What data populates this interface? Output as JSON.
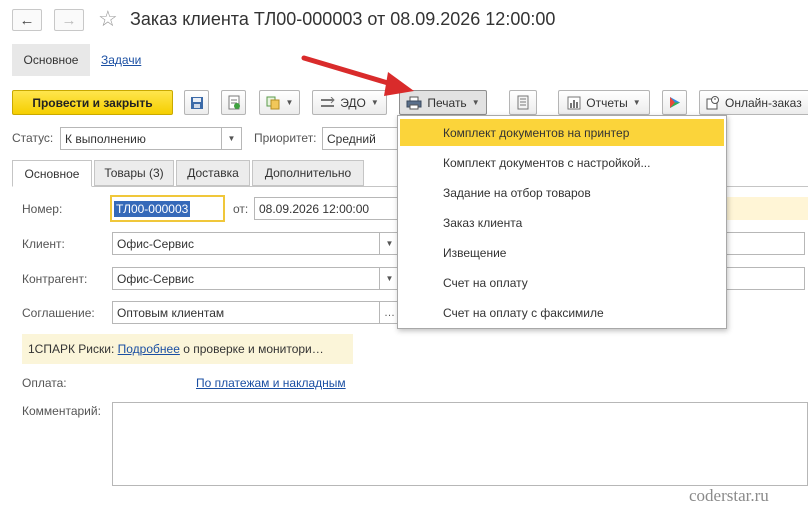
{
  "window": {
    "title": "Заказ клиента ТЛ00-000003 от 08.09.2026 12:00:00",
    "back_icon": "arrow-left-icon",
    "forward_icon": "arrow-right-icon"
  },
  "sections": {
    "main": "Основное",
    "tasks": "Задачи"
  },
  "toolbar": {
    "post_close": "Провести и закрыть",
    "edo": "ЭДО",
    "print": "Печать",
    "reports": "Отчеты",
    "online": "Онлайн-заказ"
  },
  "status": {
    "label": "Статус:",
    "value": "К выполнению",
    "priority_label": "Приоритет:",
    "priority_value": "Средний"
  },
  "tabs": [
    {
      "label": "Основное"
    },
    {
      "label": "Товары (3)"
    },
    {
      "label": "Доставка"
    },
    {
      "label": "Дополнительно"
    }
  ],
  "form": {
    "number_label": "Номер:",
    "number_value": "ТЛ00-000003",
    "date_label": "от:",
    "date_value": "08.09.2026 12:00:00",
    "client_label": "Клиент:",
    "client_value": "Офис-Сервис",
    "contractor_label": "Контрагент:",
    "contractor_value": "Офис-Сервис",
    "agreement_label": "Соглашение:",
    "agreement_value": "Оптовым клиентам",
    "spark_prefix": "1СПАРК Риски:",
    "spark_link": "Подробнее",
    "spark_suffix": "о проверке и монитори…",
    "payment_label": "Оплата:",
    "payment_link": "По платежам и накладным",
    "comment_label": "Комментарий:"
  },
  "print_menu": [
    {
      "label": "Комплект документов на принтер"
    },
    {
      "label": "Комплект документов с настройкой..."
    },
    {
      "label": "Задание на отбор товаров"
    },
    {
      "label": "Заказ клиента"
    },
    {
      "label": "Извещение"
    },
    {
      "label": "Счет на оплату"
    },
    {
      "label": "Счет на оплату с факсимиле"
    }
  ],
  "watermark": "coderstar.ru",
  "colors": {
    "accent_yellow": "#f5cf00",
    "menu_highlight": "#fbd43a",
    "link": "#1a4fa3",
    "arrow": "#d92b2b"
  }
}
